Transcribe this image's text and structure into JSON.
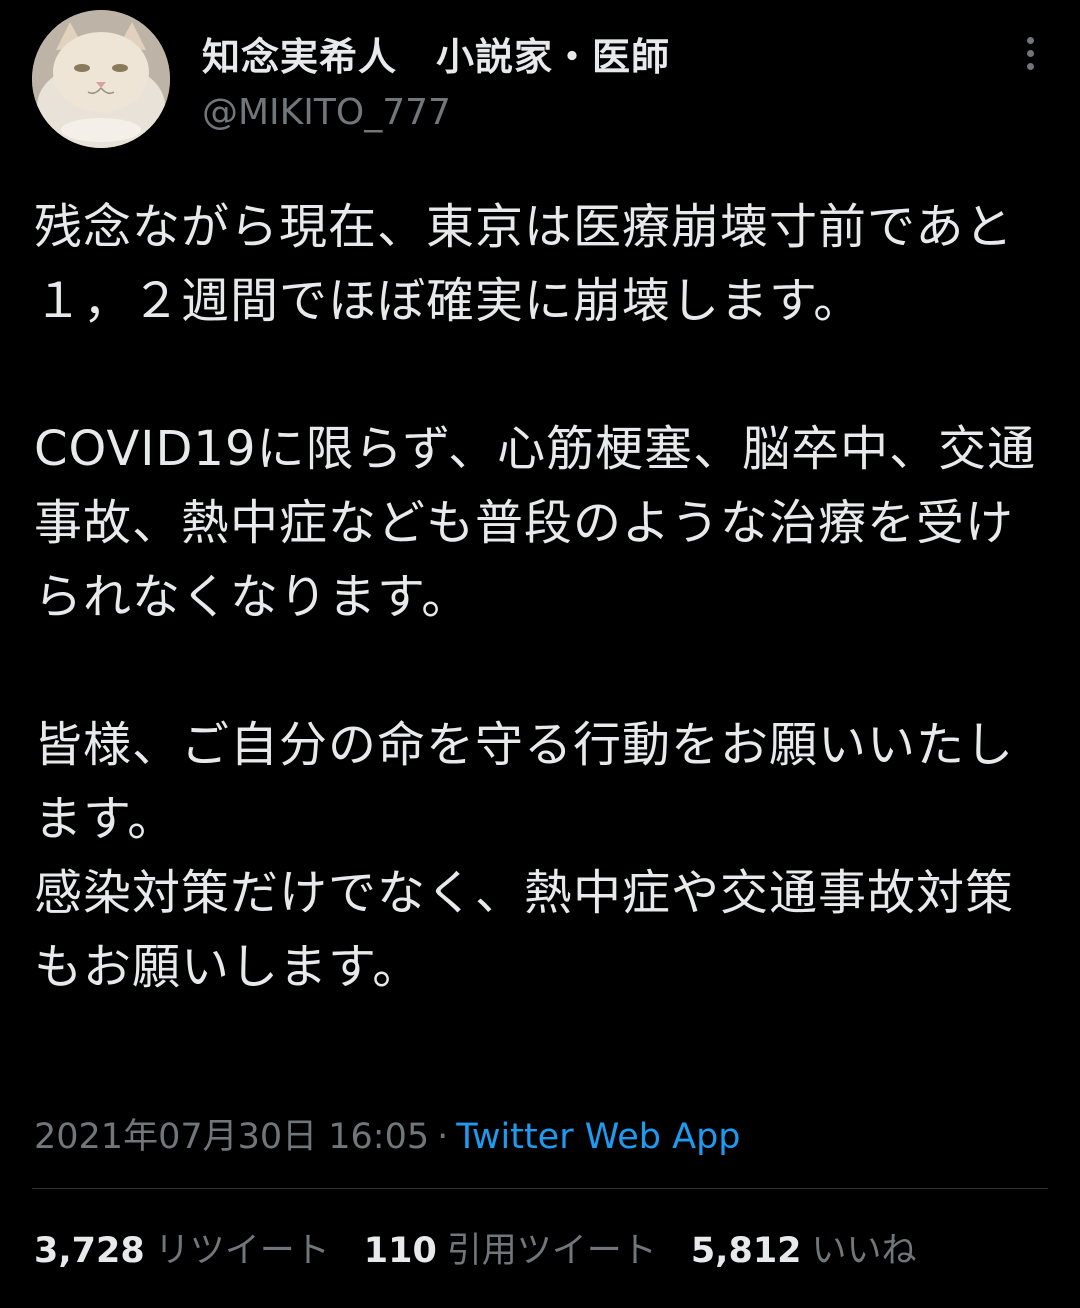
{
  "author": {
    "display_name": "知念実希人　小説家・医師",
    "handle": "@MIKITO_777",
    "avatar": "cat-avatar"
  },
  "menu": {
    "icon": "more-vertical-icon"
  },
  "tweet": {
    "text": "残念ながら現在、東京は医療崩壊寸前であと１，２週間でほぼ確実に崩壊します。\n\nCOVID19に限らず、心筋梗塞、脳卒中、交通事故、熱中症なども普段のような治療を受けられなくなります。\n\n皆様、ご自分の命を守る行動をお願いいたします。\n感染対策だけでなく、熱中症や交通事故対策もお願いします。",
    "timestamp": "2021年07月30日 16:05",
    "separator": "·",
    "source": "Twitter Web App"
  },
  "stats": {
    "retweets_count": "3,728",
    "retweets_label": "リツイート",
    "quotes_count": "110",
    "quotes_label": "引用ツイート",
    "likes_count": "5,812",
    "likes_label": "いいね"
  },
  "colors": {
    "background": "#000000",
    "text": "#e7e9ea",
    "muted": "#71767b",
    "link": "#1d9bf0",
    "divider": "#2f3336"
  }
}
